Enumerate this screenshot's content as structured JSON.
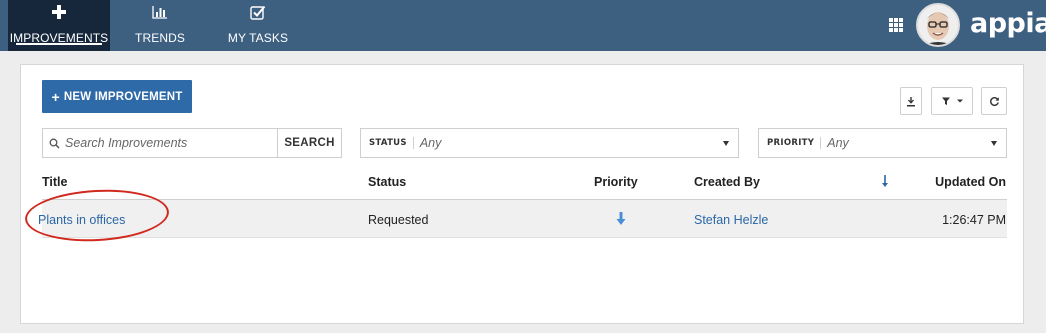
{
  "nav": {
    "tabs": [
      {
        "label": "IMPROVEMENTS",
        "icon": "plus-icon",
        "active": true
      },
      {
        "label": "TRENDS",
        "icon": "bar-chart-icon",
        "active": false
      },
      {
        "label": "MY TASKS",
        "icon": "checkbox-icon",
        "active": false
      }
    ],
    "logo": "appian"
  },
  "toolbar": {
    "new_label": "NEW IMPROVEMENT"
  },
  "search": {
    "placeholder": "Search Improvements",
    "value": "",
    "button_label": "SEARCH"
  },
  "filters": {
    "status": {
      "label": "STATUS",
      "value": "Any"
    },
    "priority": {
      "label": "PRIORITY",
      "value": "Any"
    }
  },
  "table": {
    "columns": [
      "Title",
      "Status",
      "Priority",
      "Created By",
      "Updated On"
    ],
    "sort_icon": "sort-down-arrow-icon",
    "rows": [
      {
        "title": "Plants in offices",
        "status": "Requested",
        "priority_icon": "low-priority-arrow-icon",
        "created_by": "Stefan Helzle",
        "updated_on": "1:26:47 PM"
      }
    ]
  },
  "colors": {
    "nav_bg": "#3d5f80",
    "nav_active": "#16273c",
    "primary_button": "#2e6aa8",
    "link": "#2a67a6",
    "priority_arrow": "#4a8fd6",
    "annotation_circle": "#d02a1f"
  }
}
